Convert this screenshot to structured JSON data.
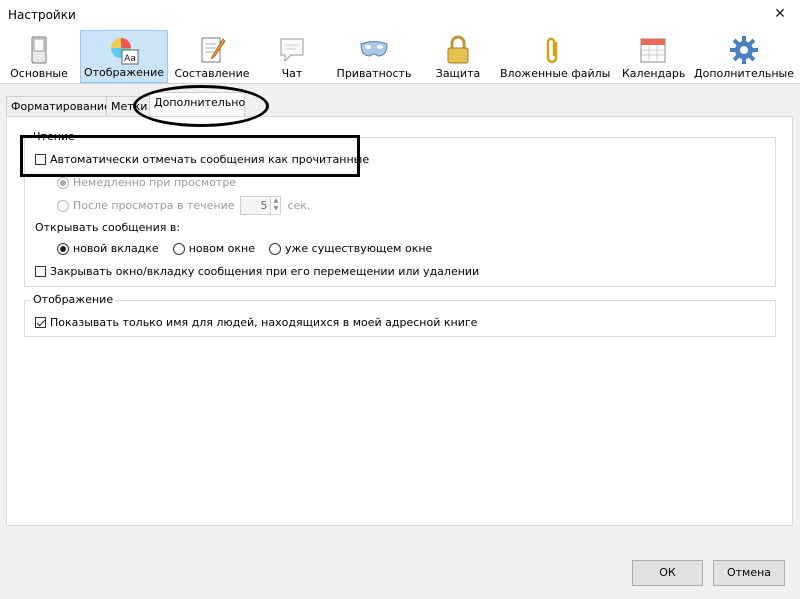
{
  "window": {
    "title": "Настройки",
    "close_glyph": "✕"
  },
  "toolbar": {
    "panes": [
      {
        "label": "Основные",
        "icon": "switch-icon",
        "selected": false
      },
      {
        "label": "Отображение",
        "icon": "color-wheel-text-icon",
        "selected": true
      },
      {
        "label": "Составление",
        "icon": "notepad-pencil-icon",
        "selected": false
      },
      {
        "label": "Чат",
        "icon": "speech-bubble-icon",
        "selected": false
      },
      {
        "label": "Приватность",
        "icon": "mask-icon",
        "selected": false
      },
      {
        "label": "Защита",
        "icon": "padlock-icon",
        "selected": false
      },
      {
        "label": "Вложенные файлы",
        "icon": "paperclip-icon",
        "selected": false
      },
      {
        "label": "Календарь",
        "icon": "calendar-icon",
        "selected": false
      },
      {
        "label": "Дополнительные",
        "icon": "gear-icon",
        "selected": false
      }
    ]
  },
  "tabs": [
    {
      "label": "Форматирование",
      "active": false
    },
    {
      "label": "Метки",
      "active": false
    },
    {
      "label": "Дополнительно",
      "active": true
    }
  ],
  "reading": {
    "legend": "Чтение",
    "auto_mark_label": "Автоматически отмечать сообщения как прочитанные",
    "auto_mark_checked": false,
    "immediately_label": "Немедленно при просмотре",
    "after_label": "После просмотра в течение",
    "delay_value": "5",
    "seconds_label": "сек.",
    "open_in_label": "Открывать сообщения в:",
    "open_options": [
      "новой вкладке",
      "новом окне",
      "уже существующем окне"
    ],
    "open_selected": 0,
    "close_label": "Закрывать окно/вкладку сообщения при его перемещении или удалении",
    "close_checked": false
  },
  "display": {
    "legend": "Отображение",
    "only_name_label": "Показывать только имя для людей, находящихся в моей адресной книге",
    "only_name_checked": true
  },
  "buttons": {
    "ok": "ОК",
    "cancel": "Отмена"
  },
  "colors": {
    "selected_pane": "#cce4f7",
    "selected_pane_border": "#99c9ef",
    "gear_blue": "#4a7fc0"
  }
}
